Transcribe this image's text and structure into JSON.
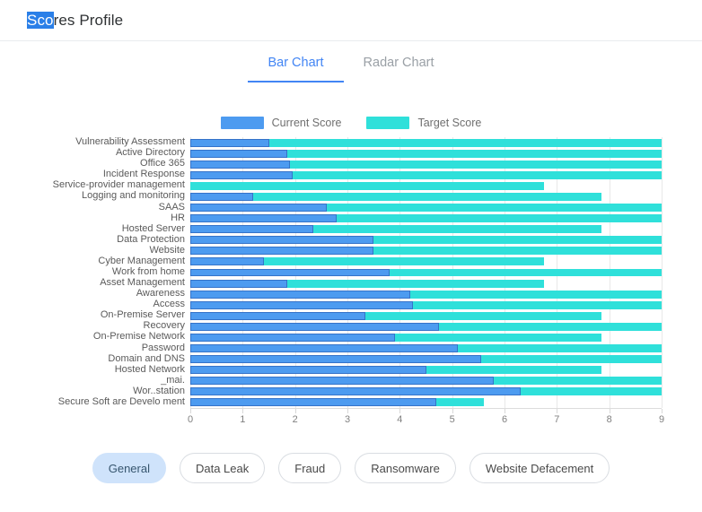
{
  "header": {
    "title_selected": "Sco",
    "title_rest": "res Profile"
  },
  "tabs": [
    {
      "label": "Bar Chart",
      "active": true
    },
    {
      "label": "Radar Chart",
      "active": false
    }
  ],
  "legend": [
    {
      "label": "Current Score",
      "color": "#4d9bf0"
    },
    {
      "label": "Target Score",
      "color": "#2fe0da"
    }
  ],
  "filters": [
    {
      "label": "General",
      "active": true
    },
    {
      "label": "Data Leak",
      "active": false
    },
    {
      "label": "Fraud",
      "active": false
    },
    {
      "label": "Ransomware",
      "active": false
    },
    {
      "label": "Website Defacement",
      "active": false
    }
  ],
  "chart_data": {
    "type": "bar",
    "orientation": "horizontal",
    "title": "",
    "xlabel": "",
    "ylabel": "",
    "xlim": [
      0,
      9
    ],
    "xticks": [
      0,
      1,
      2,
      3,
      4,
      5,
      6,
      7,
      8,
      9
    ],
    "grid": true,
    "legend_position": "top-center",
    "categories": [
      "Vulnerability Assessment",
      "Active Directory",
      "Office 365",
      "Incident Response",
      "Service-provider management",
      "Logging and monitoring",
      "SAAS",
      "HR",
      "Hosted Server",
      "Data Protection",
      "Website",
      "Cyber Management",
      "Work from home",
      "Asset Management",
      "Awareness",
      "Access",
      "On-Premise Server",
      "Recovery",
      "On-Premise Network",
      "Password",
      "Domain and DNS",
      "Hosted Network",
      "_mai.",
      "Wor..station",
      "Secure Soft  are Develo  ment"
    ],
    "series": [
      {
        "name": "Current Score",
        "color": "#4d9bf0",
        "values": [
          1.5,
          1.85,
          1.9,
          1.95,
          0,
          1.2,
          2.6,
          2.8,
          2.35,
          3.5,
          3.5,
          1.4,
          3.8,
          1.85,
          4.2,
          4.25,
          3.35,
          4.75,
          3.9,
          5.1,
          5.55,
          4.5,
          5.8,
          6.3,
          4.7
        ]
      },
      {
        "name": "Target Score",
        "color": "#2fe0da",
        "values": [
          9,
          9,
          9,
          9,
          6.75,
          7.85,
          9,
          9,
          7.85,
          9,
          9,
          6.75,
          9,
          6.75,
          9,
          9,
          7.85,
          9,
          7.85,
          9,
          9,
          7.85,
          9,
          9,
          5.6
        ]
      }
    ]
  }
}
